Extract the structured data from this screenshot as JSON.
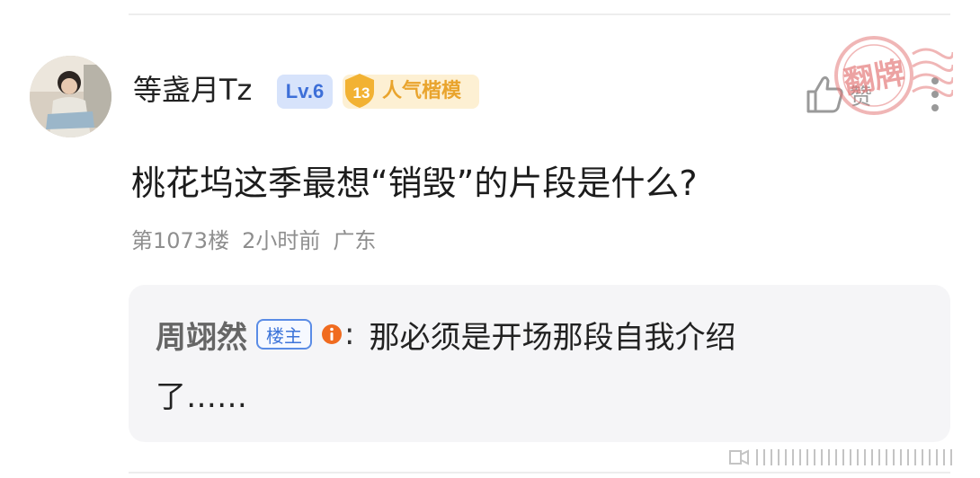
{
  "post": {
    "username": "等盏月Tz",
    "level": "Lv.6",
    "popularity_rank": "13",
    "popularity_label": "人气楷模",
    "like_label": "赞",
    "stamp_text": "翻牌",
    "question": "桃花坞这季最想“销毁”的片段是什么?",
    "meta": {
      "floor": "第1073楼",
      "time": "2小时前",
      "location": "广东"
    }
  },
  "reply": {
    "author": "周翊然",
    "owner_badge": "楼主",
    "colon": ":",
    "text_line1": "那必须是开场那段自我介绍",
    "text_line2": "了……"
  },
  "colors": {
    "accent_blue": "#3d74d9",
    "gold": "#e9a42d",
    "stamp_red": "#e57b7b",
    "info_orange": "#f06b1f"
  }
}
